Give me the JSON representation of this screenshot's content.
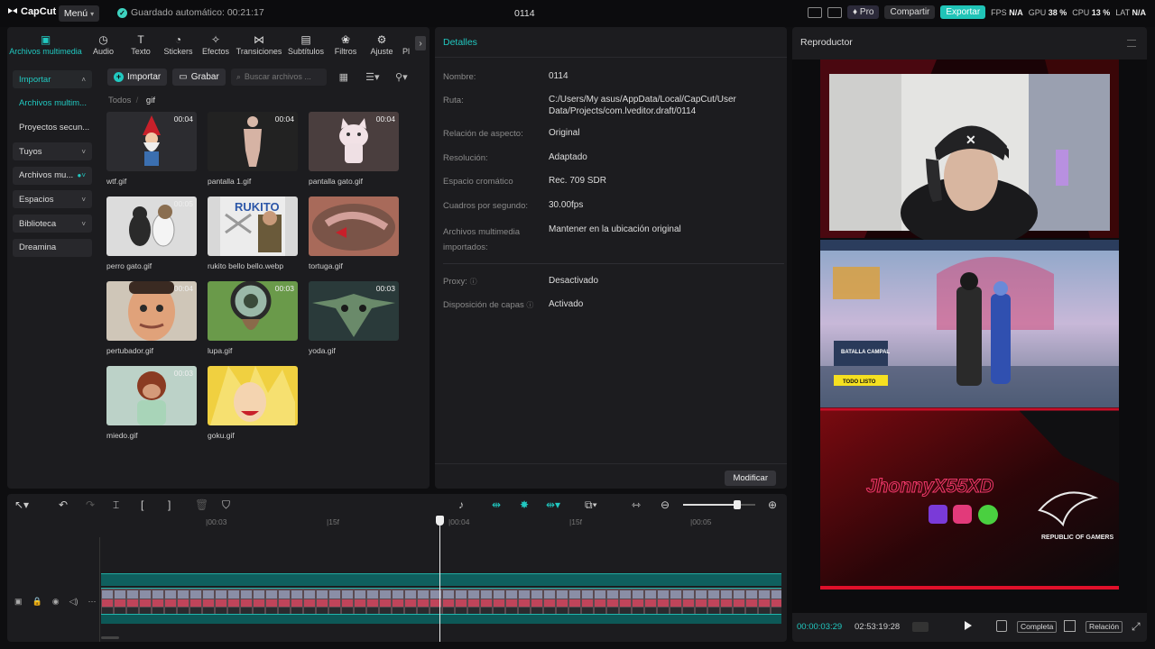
{
  "topbar": {
    "logo": "CapCut",
    "menu": "Menú",
    "autosave": "Guardado automático: 00:21:17",
    "title": "0114",
    "pro": "Pro",
    "share": "Compartir",
    "export": "Exportar",
    "fps_label": "FPS",
    "fps_value": "N/A",
    "gpu_label": "GPU",
    "gpu_value": "38 %",
    "cpu_label": "CPU",
    "cpu_value": "13 %",
    "lat_label": "LAT",
    "lat_value": "N/A"
  },
  "toolbar": {
    "items": [
      {
        "label": "Archivos multimedia",
        "icon": "media-icon"
      },
      {
        "label": "Audio",
        "icon": "audio-icon"
      },
      {
        "label": "Texto",
        "icon": "text-icon"
      },
      {
        "label": "Stickers",
        "icon": "sticker-icon"
      },
      {
        "label": "Efectos",
        "icon": "effects-icon"
      },
      {
        "label": "Transiciones",
        "icon": "transitions-icon"
      },
      {
        "label": "Subtítulos",
        "icon": "subtitles-icon"
      },
      {
        "label": "Filtros",
        "icon": "filters-icon"
      },
      {
        "label": "Ajuste",
        "icon": "adjust-icon"
      },
      {
        "label": "Pl",
        "icon": "plugin-icon"
      }
    ]
  },
  "sidebar": {
    "items": [
      {
        "label": "Importar"
      },
      {
        "label": "Archivos multim..."
      },
      {
        "label": "Proyectos secun..."
      },
      {
        "label": "Tuyos"
      },
      {
        "label": "Archivos mu..."
      },
      {
        "label": "Espacios"
      },
      {
        "label": "Biblioteca"
      },
      {
        "label": "Dreamina"
      }
    ]
  },
  "media": {
    "import_button": "Importar",
    "record_button": "Grabar",
    "search_placeholder": "Buscar archivos ...",
    "crumb_root": "Todos",
    "crumb_current": "gif",
    "files": [
      {
        "name": "wtf.gif",
        "duration": "00:04"
      },
      {
        "name": "pantalla 1.gif",
        "duration": "00:04"
      },
      {
        "name": "pantalla gato.gif",
        "duration": "00:04"
      },
      {
        "name": "perro gato.gif",
        "duration": "00:05"
      },
      {
        "name": "rukito bello bello.webp",
        "duration": ""
      },
      {
        "name": "tortuga.gif",
        "duration": ""
      },
      {
        "name": "pertubador.gif",
        "duration": "00:04"
      },
      {
        "name": "lupa.gif",
        "duration": "00:03"
      },
      {
        "name": "yoda.gif",
        "duration": "00:03"
      },
      {
        "name": "miedo.gif",
        "duration": "00:03"
      },
      {
        "name": "goku.gif",
        "duration": ""
      }
    ]
  },
  "details": {
    "title": "Detalles",
    "rows": [
      {
        "label": "Nombre:",
        "value": "0114"
      },
      {
        "label": "Ruta:",
        "value": "C:/Users/My asus/AppData/Local/CapCut/User Data/Projects/com.lveditor.draft/0114"
      },
      {
        "label": "Relación de aspecto:",
        "value": "Original"
      },
      {
        "label": "Resolución:",
        "value": "Adaptado"
      },
      {
        "label": "Espacio cromático",
        "value": "Rec. 709 SDR"
      },
      {
        "label": "Cuadros por segundo:",
        "value": "30.00fps"
      },
      {
        "label": "Archivos multimedia importados:",
        "value": "Mantener en la ubicación original"
      },
      {
        "label": "Proxy:",
        "value": "Desactivado"
      },
      {
        "label": "Disposición de capas",
        "value": "Activado"
      }
    ],
    "modify_button": "Modificar"
  },
  "player": {
    "title": "Reproductor",
    "current_time": "00:00:03:29",
    "total_time": "02:53:19:28",
    "full_button": "Completa",
    "ratio_button": "Relación",
    "overlay_name": "JhonnyX55XD",
    "brand": "REPUBLIC OF GAMERS",
    "game_title": "BATALLA CAMPAL",
    "ready_button": "TODO LISTO"
  },
  "timeline": {
    "ticks": [
      "00:03",
      "15f",
      "00:04",
      "15f",
      "00:05"
    ]
  }
}
